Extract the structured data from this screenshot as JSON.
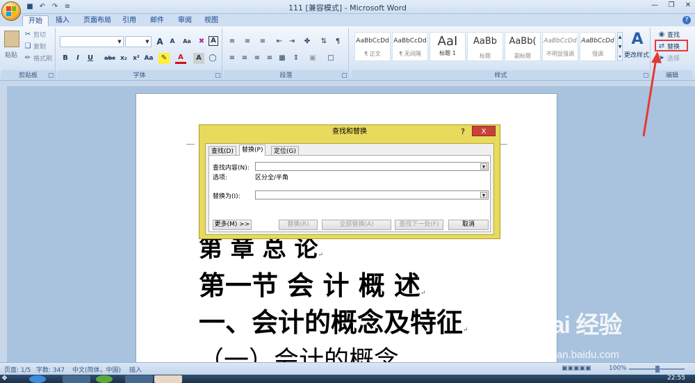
{
  "window": {
    "title": "111 [兼容模式] - Microsoft Word",
    "qat": [
      "save-icon",
      "undo-icon",
      "redo-icon",
      "customize-icon"
    ]
  },
  "tabs": [
    "开始",
    "插入",
    "页面布局",
    "引用",
    "邮件",
    "审阅",
    "视图"
  ],
  "ribbon": {
    "clipboard": {
      "paste": "粘贴",
      "cut": "剪切",
      "copy": "复制",
      "format_painter": "格式刷",
      "label": "剪贴板"
    },
    "font": {
      "label": "字体",
      "font_name": "",
      "font_size": "",
      "bold": "B",
      "italic": "I",
      "underline": "U",
      "strike": "abc",
      "subscript": "x₂",
      "superscript": "x²",
      "grow": "A",
      "shrink": "A",
      "clear": "Aa",
      "font_color": "A",
      "char_border": "A"
    },
    "paragraph": {
      "label": "段落"
    },
    "styles": {
      "label": "样式",
      "items": [
        {
          "sample": "AaBbCcDd",
          "name": "¶ 正文"
        },
        {
          "sample": "AaBbCcDd",
          "name": "¶ 无间隔"
        },
        {
          "sample": "AaI",
          "name": "标题 1"
        },
        {
          "sample": "AaBb",
          "name": "标题"
        },
        {
          "sample": "AaBb(",
          "name": "副标题"
        },
        {
          "sample": "AaBbCcDd",
          "name": "不明显强调"
        },
        {
          "sample": "AaBbCcDd",
          "name": "强调"
        }
      ],
      "change_styles": "更改样式"
    },
    "editing": {
      "label": "编辑",
      "find": "查找",
      "replace": "替换",
      "select": "选择"
    }
  },
  "document": {
    "lines": [
      "第   章   总   论",
      "第一节  会 计 概 述",
      "一、会计的概念及特征",
      "（一）会计的概念"
    ]
  },
  "dialog": {
    "title": "查找和替换",
    "help": "?",
    "close": "X",
    "tabs": [
      "查找(D)",
      "替换(P)",
      "定位(G)"
    ],
    "find_label": "查找内容(N):",
    "find_value": "",
    "options_label": "选项:",
    "options_value": "区分全/半角",
    "replace_label": "替换为(I):",
    "replace_value": "",
    "buttons": {
      "more": "更多(M) >>",
      "replace": "替换(R)",
      "replace_all": "全部替换(A)",
      "find_next": "查找下一处(F)",
      "cancel": "取消"
    }
  },
  "statusbar": {
    "page": "页面: 1/5",
    "words": "字数: 347",
    "language": "中文(简体，中国)",
    "mode": "插入",
    "zoom": "100%",
    "zoom_value": 100
  },
  "taskbar": {
    "clock": "22:55"
  },
  "watermark": {
    "brand": "Bai  经验",
    "url": "jingyan.baidu.com"
  },
  "colors": {
    "highlight_box": "#e53935",
    "dialog_frame": "#e8da5c",
    "close_button": "#c9423a"
  }
}
